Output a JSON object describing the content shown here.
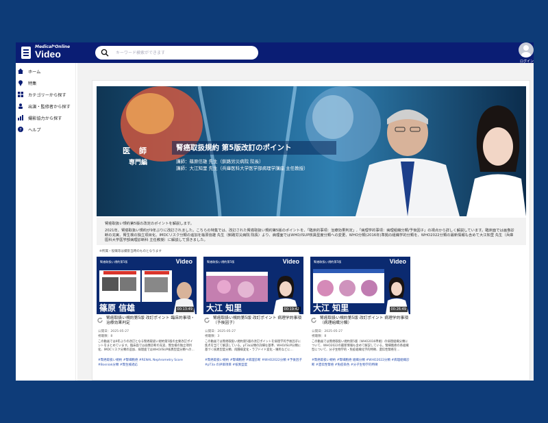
{
  "app": {
    "logo_small": "Medical*Online",
    "logo_big": "Video",
    "login_label": "ログイン"
  },
  "search": {
    "placeholder": "キーワード検索ができます"
  },
  "sidebar": {
    "items": [
      {
        "label": "ホーム",
        "icon": "home-icon"
      },
      {
        "label": "特集",
        "icon": "pin-icon"
      },
      {
        "label": "カテゴリーから探す",
        "icon": "grid-icon"
      },
      {
        "label": "出演・監修者から探す",
        "icon": "person-icon"
      },
      {
        "label": "撮影協力から探す",
        "icon": "bar-chart-icon"
      },
      {
        "label": "ヘルプ",
        "icon": "help-icon"
      }
    ]
  },
  "hero": {
    "badge_doctor": "医　師",
    "badge_specialist": "専門編",
    "title": "腎癌取扱規約 第5版改訂のポイント",
    "lecturer1": "講師：篠原信雄 先生（釧路労災病院 院長）",
    "lecturer2": "講師：大江知里 先生（兵庫医科大学医学部病理学講座 主任教授）"
  },
  "description": {
    "line1": "腎癌取扱い規約第5版の改定のポイントを解説します。",
    "line2": "2021年、腎癌取扱い規約が9年ぶりに改訂されました。こちらの特集では、改訂された腎癌取扱い規約第5版のポイントを、「臨床的事項：治療効果判定」,「病理学的事項：病理組織分類/予後因子」の視点から詳しく解説しています。臨床面では画像診断の充実、腎生検の独立項目化、IMDCリスク分類の追加を篠原信雄 先生（釧路労災病院 院長）より、病理面ではWHO/ISUP核異型度分類への変更、WHO分類(2016年)準拠の組織学的分類を、WHO2022分類の最新情報も含めて大江知里 先生（兵庫医科大学医学部病理診断科 主任教授）に解説して頂きました。",
    "note": "※所属・役職等は撮影当時のものとなります"
  },
  "cards": [
    {
      "brand": "腎癌取扱い規約第5版",
      "thumb_name": "篠原 信雄",
      "duration": "00:13:49",
      "title": "腎癌取扱い規約第5版 改訂ポイント 臨床的事項・治療効果判定",
      "published": "公開日：2025-05-27",
      "views": "視聴数：8",
      "body": "この動画では9年ぶりの改訂となる腎癌取扱い規約第5版の主要改訂ポイントをまとめています。臨床面では画像診断の充実、腎生検の独立項目化、IMDCリスク分類の追加、病理面ではWHO/ISUP核異型度分類への…",
      "tags": "#腎癌取扱い規約 #腎細胞癌 #RENAL Nephrometry Score #Bosniak分類 #腎生検適応"
    },
    {
      "brand": "腎癌取扱い規約第5版",
      "thumb_name": "大江 知里",
      "duration": "00:19:42",
      "title": "腎癌取扱い規約第5版 改訂ポイント 病理学的事項（予後因子）",
      "published": "公開日：2025-05-27",
      "views": "視聴数：3",
      "body": "この動画では腎癌取扱い規約第5版の改訂ポイントを病理学的予後因子に焦点を当てて解説している。pT3a分類の詳細な基準、WHO/ISUP分類に基づく核異型度分類、肉腫様変化・ラブドイド変化・壊死などに…",
      "tags": "#腎癌取扱い規約 #腎細胞癌 #病理診断 #WHO2022分類 #予後因子 #pT3a の評価項目 #核異型度"
    },
    {
      "brand": "腎癌取扱い規約第5版",
      "thumb_name": "大江 知里",
      "duration": "00:26:49",
      "title": "腎癌取扱い規約第5版 改訂ポイント 病理学的事項（病理組織分類）",
      "published": "公開日：2025-05-27",
      "views": "視聴数：8",
      "body": "この動画では腎癌取扱い規約第5版（WHO2016準拠）の病理組織分類について、WHO2022の最新情報も含めて解説している。腎細胞癌の各組織型について、分子生物学的・免疫組織化学的特徴、遺伝性腎癌を…",
      "tags": "#腎癌取扱い規約 #腎細胞癌 組織分類 #WHO2022分類 #病理組織診断 #遺伝性腎癌 #免疫染色 #分子生物学的特徴"
    }
  ],
  "colors": {
    "header": "#0a1d74",
    "page_bg": "#0d3b77",
    "tag": "#2a4fae"
  }
}
